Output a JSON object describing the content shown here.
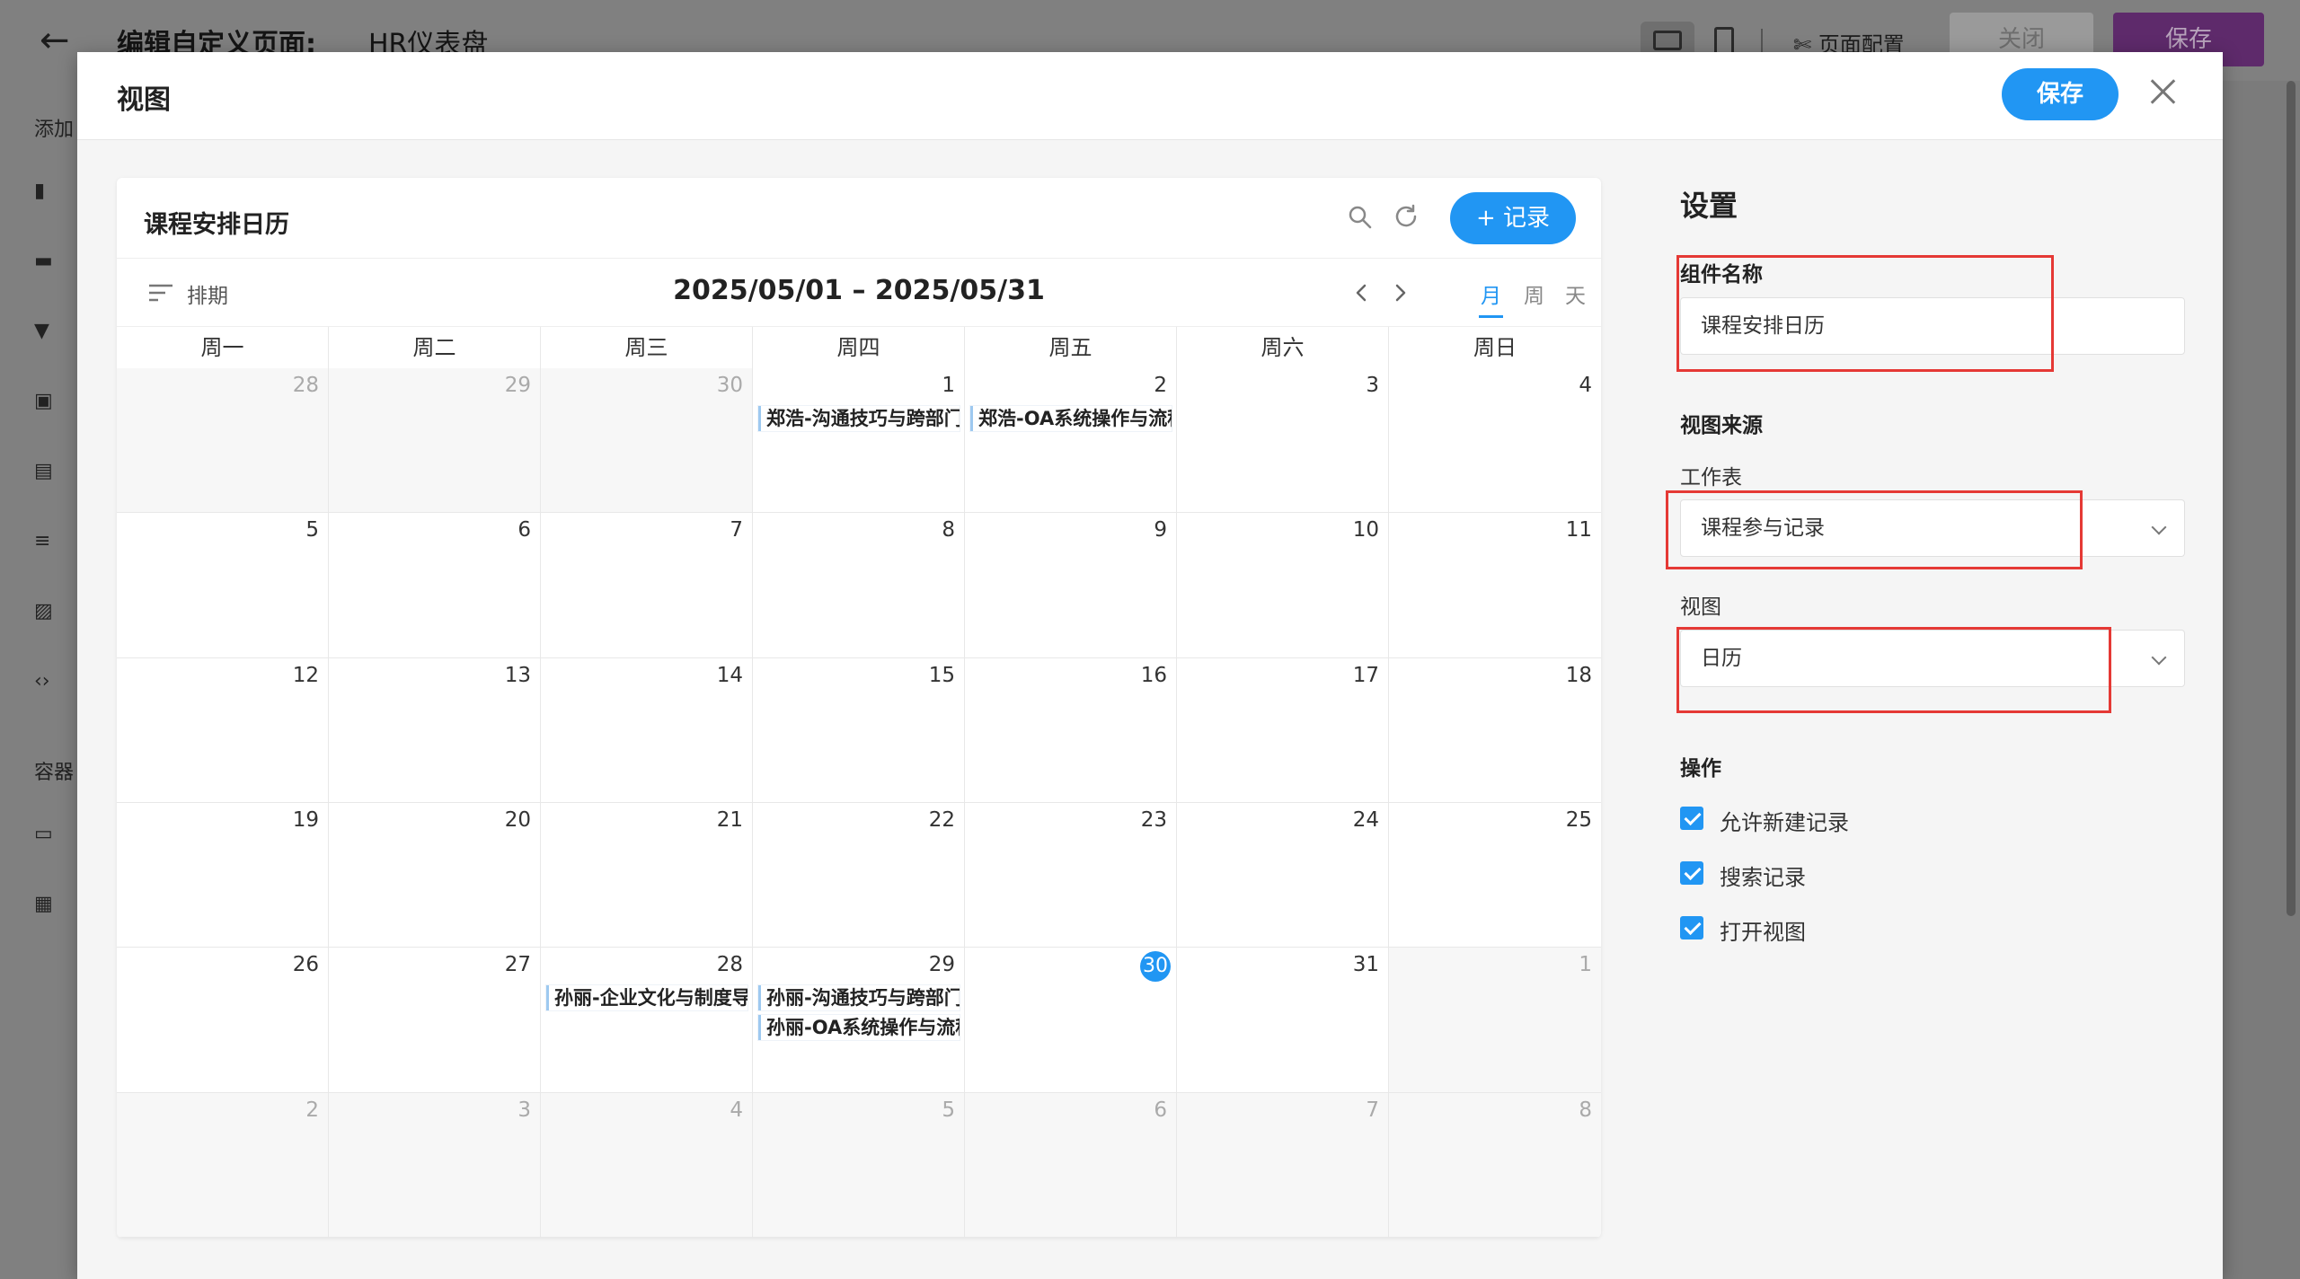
{
  "bg": {
    "back": "←",
    "title": "编辑自定义页面:",
    "page_name": "HR仪表盘",
    "config_label": "页面配置",
    "close_label": "关闭",
    "save_label": "保存",
    "sidebar_add": "添加",
    "sidebar_container": "容器"
  },
  "modal": {
    "title": "视图",
    "save_label": "保存"
  },
  "calendar": {
    "title": "课程安排日历",
    "add_label": "+ 记录",
    "sort_label": "排期",
    "range": "2025/05/01 – 2025/05/31",
    "view_month": "月",
    "view_week": "周",
    "view_day": "天",
    "weekdays": [
      "周一",
      "周二",
      "周三",
      "周四",
      "周五",
      "周六",
      "周日"
    ],
    "weeks": [
      [
        {
          "d": "28",
          "o": true
        },
        {
          "d": "29",
          "o": true
        },
        {
          "d": "30",
          "o": true
        },
        {
          "d": "1",
          "ev": [
            "郑浩-沟通技巧与跨部门"
          ]
        },
        {
          "d": "2",
          "ev": [
            "郑浩-OA系统操作与流程"
          ]
        },
        {
          "d": "3"
        },
        {
          "d": "4"
        }
      ],
      [
        {
          "d": "5"
        },
        {
          "d": "6"
        },
        {
          "d": "7"
        },
        {
          "d": "8"
        },
        {
          "d": "9"
        },
        {
          "d": "10"
        },
        {
          "d": "11"
        }
      ],
      [
        {
          "d": "12"
        },
        {
          "d": "13"
        },
        {
          "d": "14"
        },
        {
          "d": "15"
        },
        {
          "d": "16"
        },
        {
          "d": "17"
        },
        {
          "d": "18"
        }
      ],
      [
        {
          "d": "19"
        },
        {
          "d": "20"
        },
        {
          "d": "21"
        },
        {
          "d": "22"
        },
        {
          "d": "23"
        },
        {
          "d": "24"
        },
        {
          "d": "25"
        }
      ],
      [
        {
          "d": "26"
        },
        {
          "d": "27"
        },
        {
          "d": "28",
          "ev": [
            "孙丽-企业文化与制度导"
          ]
        },
        {
          "d": "29",
          "ev": [
            "孙丽-沟通技巧与跨部门",
            "孙丽-OA系统操作与流程"
          ]
        },
        {
          "d": "30",
          "today": true
        },
        {
          "d": "31"
        },
        {
          "d": "1",
          "o": true
        }
      ],
      [
        {
          "d": "2",
          "o": true
        },
        {
          "d": "3",
          "o": true
        },
        {
          "d": "4",
          "o": true
        },
        {
          "d": "5",
          "o": true
        },
        {
          "d": "6",
          "o": true
        },
        {
          "d": "7",
          "o": true
        },
        {
          "d": "8",
          "o": true
        }
      ]
    ]
  },
  "settings": {
    "title": "设置",
    "component_name_label": "组件名称",
    "component_name_value": "课程安排日历",
    "source_label": "视图来源",
    "worksheet_label": "工作表",
    "worksheet_value": "课程参与记录",
    "view_label": "视图",
    "view_value": "日历",
    "ops_label": "操作",
    "ops": [
      "允许新建记录",
      "搜索记录",
      "打开视图"
    ]
  },
  "colors": {
    "accent": "#2196f3",
    "highlight_box": "#e53935"
  }
}
